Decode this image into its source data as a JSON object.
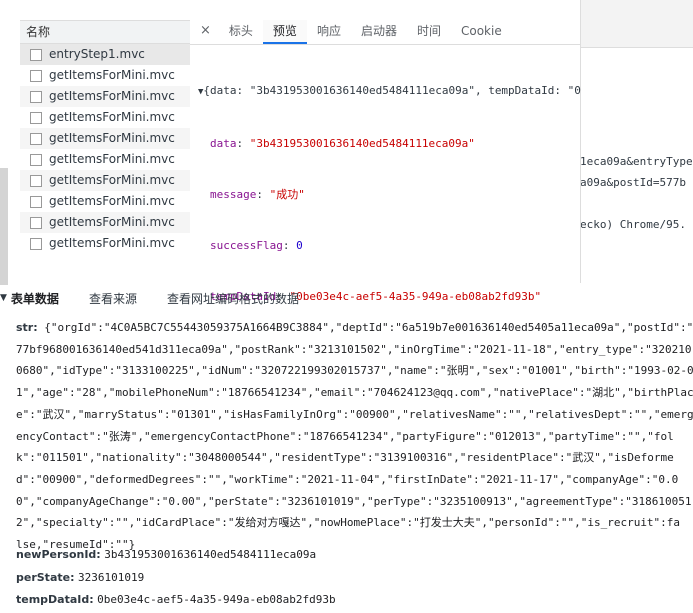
{
  "request_list": {
    "header": "名称",
    "items": [
      {
        "label": "entryStep1.mvc"
      },
      {
        "label": "getItemsForMini.mvc"
      },
      {
        "label": "getItemsForMini.mvc"
      },
      {
        "label": "getItemsForMini.mvc"
      },
      {
        "label": "getItemsForMini.mvc"
      },
      {
        "label": "getItemsForMini.mvc"
      },
      {
        "label": "getItemsForMini.mvc"
      },
      {
        "label": "getItemsForMini.mvc"
      },
      {
        "label": "getItemsForMini.mvc"
      },
      {
        "label": "getItemsForMini.mvc"
      }
    ]
  },
  "detail_tabs": {
    "close": "×",
    "items": [
      "标头",
      "预览",
      "响应",
      "启动器",
      "时间",
      "Cookie"
    ],
    "active": "预览"
  },
  "preview": {
    "summary": "{data: \"3b431953001636140ed5484111eca09a\", tempDataId: \"0",
    "rows": [
      {
        "key": "data",
        "value": "\"3b431953001636140ed5484111eca09a\"",
        "type": "string"
      },
      {
        "key": "message",
        "value": "\"成功\"",
        "type": "string"
      },
      {
        "key": "successFlag",
        "value": "0",
        "type": "number"
      },
      {
        "key": "tempDataId",
        "value": "\"0be03e4c-aef5-4a35-949a-eb08ab2fd93b\"",
        "type": "string"
      }
    ]
  },
  "background_lines": [
    "1eca09a&entryType",
    "a09a&postId=577b",
    "ecko) Chrome/95."
  ],
  "form_data": {
    "section_title": "表单数据",
    "view_source": "查看来源",
    "view_url_encoded": "查看网址编码格式的数据",
    "str_name": "str:",
    "str_lines": [
      "{\"orgId\":\"4C0A5BC7C55443059375A1664B9C3884\",\"deptId\":\"6a519b7e001636140ed5405a11eca09a\",\"postId\":\"5",
      "77bf968001636140ed541d311eca09a\",\"postRank\":\"3213101502\",\"inOrgTime\":\"2021-11-18\",\"entry_type\":\"320210",
      "0680\",\"idType\":\"3133100225\",\"idNum\":\"320722199302015737\",\"name\":\"张明\",\"sex\":\"01001\",\"birth\":\"1993-02-0",
      "1\",\"age\":\"28\",\"mobilePhoneNum\":\"18766541234\",\"email\":\"704624123@qq.com\",\"nativePlace\":\"湖北\",\"birthPlac",
      "e\":\"武汉\",\"marryStatus\":\"01301\",\"isHasFamilyInOrg\":\"00900\",\"relativesName\":\"\",\"relativesDept\":\"\",\"emerg",
      "encyContact\":\"张涛\",\"emergencyContactPhone\":\"18766541234\",\"partyFigure\":\"012013\",\"partyTime\":\"\",\"fol",
      "k\":\"011501\",\"nationality\":\"3048000544\",\"residentType\":\"3139100316\",\"residentPlace\":\"武汉\",\"isDeforme",
      "d\":\"00900\",\"deformedDegrees\":\"\",\"workTime\":\"2021-11-04\",\"firstInDate\":\"2021-11-17\",\"companyAge\":\"0.0",
      "0\",\"companyAgeChange\":\"0.00\",\"perState\":\"3236101019\",\"perType\":\"3235100913\",\"agreementType\":\"318610051",
      "2\",\"specialty\":\"\",\"idCardPlace\":\"发给对方嘎达\",\"nowHomePlace\":\"打发士大夫\",\"personId\":\"\",\"is_recruit\":fa",
      "lse,\"resumeId\":\"\"}"
    ],
    "fields": [
      {
        "name": "newPersonId:",
        "value": "3b431953001636140ed5484111eca09a"
      },
      {
        "name": "perState:",
        "value": "3236101019"
      },
      {
        "name": "tempDataId:",
        "value": "0be03e4c-aef5-4a35-949a-eb08ab2fd93b"
      }
    ]
  },
  "colors": {
    "active_tab_underline": "#1a73e8",
    "json_key": "#881391",
    "json_string": "#c80000",
    "json_number": "#1c00cf"
  }
}
